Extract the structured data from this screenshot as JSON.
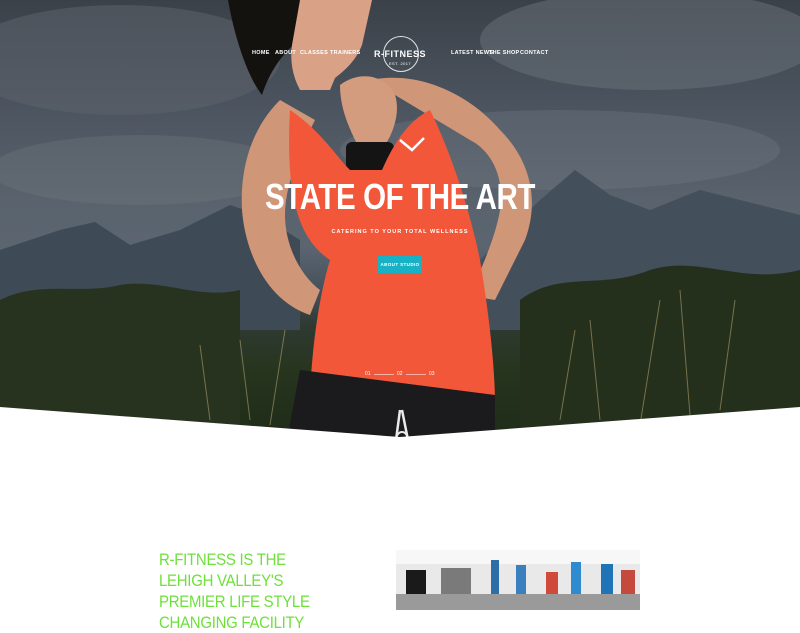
{
  "nav": {
    "left": [
      "HOME",
      "ABOUT",
      "CLASSES",
      "TRAINERS"
    ],
    "right": [
      "LATEST NEWS",
      "THE SHOP",
      "CONTACT"
    ]
  },
  "logo": {
    "name": "R-FITNESS",
    "sub": "EST. 2017"
  },
  "hero": {
    "title": "STATE OF THE ART",
    "subtitle": "CATERING TO YOUR TOTAL WELLNESS",
    "button": "ABOUT STUDIO",
    "slides": [
      "01",
      "02",
      "03"
    ]
  },
  "about": {
    "heading": "R-FITNESS IS THE LEHIGH VALLEY'S PREMIER LIFE STYLE CHANGING FACILITY"
  },
  "colors": {
    "accent": "#18b2c7",
    "heading_green": "#6ee03a"
  }
}
